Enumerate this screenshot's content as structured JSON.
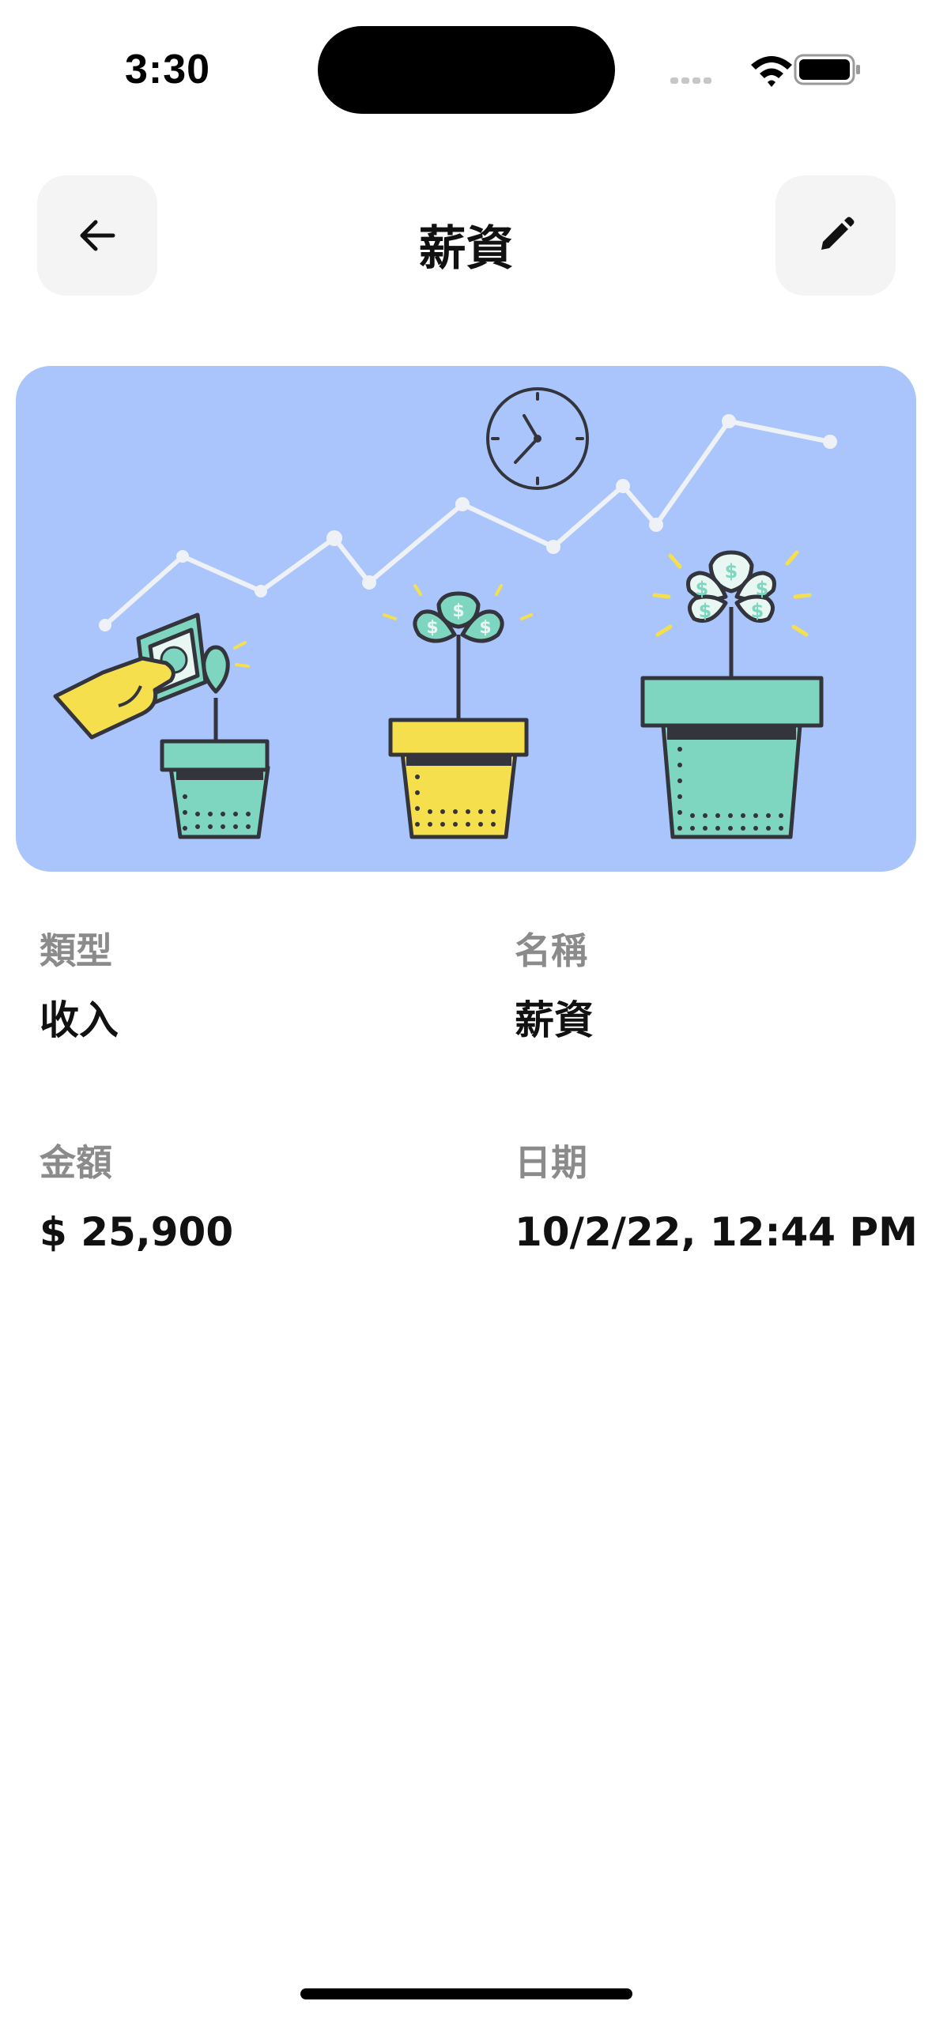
{
  "status_bar": {
    "time": "3:30"
  },
  "nav": {
    "title": "薪資"
  },
  "details": {
    "type": {
      "label": "類型",
      "value": "收入"
    },
    "name": {
      "label": "名稱",
      "value": "薪資"
    },
    "amount": {
      "label": "金額",
      "value": "$ 25,900"
    },
    "date": {
      "label": "日期",
      "value": "10/2/22, 12:44 PM"
    }
  },
  "colors": {
    "hero_background": "#aac5fb",
    "teal": "#7fd6c0",
    "yellow": "#f5df4d",
    "outline": "#34343d",
    "button_background": "#f3f4f3"
  },
  "icons": {
    "back": "arrow-left-icon",
    "edit": "pencil-icon",
    "signal": "signal-icon",
    "wifi": "wifi-icon",
    "battery": "battery-icon"
  }
}
